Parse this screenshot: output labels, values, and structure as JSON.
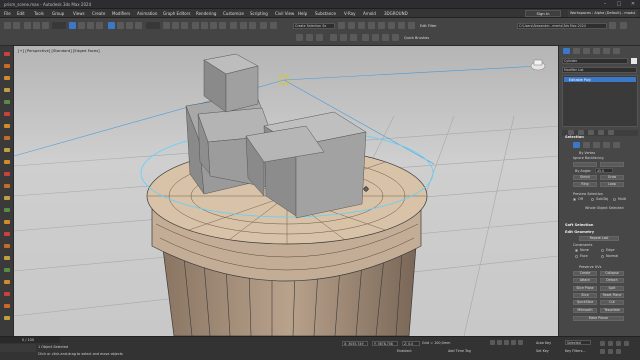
{
  "window": {
    "title": "prism_scene.max - Autodesk 3ds Max 2024"
  },
  "menu": [
    "File",
    "Edit",
    "Tools",
    "Group",
    "Views",
    "Create",
    "Modifiers",
    "Animation",
    "Graph Editors",
    "Rendering",
    "Customize",
    "Scripting",
    "Civil View",
    "Help",
    "Substance",
    "V-Ray",
    "Arnold",
    "3DGROUND"
  ],
  "signin": "Sign In",
  "workspace": "Workspaces : Alpha (Default) - modul",
  "toolbar": {
    "selection_set": "Create Selection Se",
    "path": "C:\\Users\\Alexander...ments\\3ds Max 2024",
    "quick_brushes": "Quick Brushes",
    "filter": "Edit Filter"
  },
  "viewport": {
    "label": "[+] [Perspective] [Standard] [Edged Faces]"
  },
  "command_panel": {
    "object_name": "Cylinder",
    "modifier_list": "Modifier List",
    "modifier": "Editable Poly",
    "rollouts": {
      "selection": "Selection",
      "by_vertex": "By Vertex",
      "ignore_backfacing": "Ignore Backfacing",
      "by_angle": "By Angle:",
      "angle_value": "45.0",
      "shrink": "Shrink",
      "grow": "Grow",
      "ring": "Ring",
      "loop": "Loop",
      "preview_selection": "Preview Selection",
      "off": "Off",
      "subobj": "SubObj",
      "multi": "Multi",
      "whole_object": "Whole Object Selected",
      "soft_selection": "Soft Selection",
      "edit_geometry": "Edit Geometry",
      "repeat_last": "Repeat Last",
      "constraints": "Constraints",
      "none": "None",
      "edge": "Edge",
      "face": "Face",
      "normal": "Normal",
      "preserve_uvs": "Preserve UVs",
      "create": "Create",
      "collapse": "Collapse",
      "attach": "Attach",
      "detach": "Detach",
      "slice_plane": "Slice Plane",
      "split": "Split",
      "slice": "Slice",
      "reset_plane": "Reset Plane",
      "quickslice": "QuickSlice",
      "cut": "Cut",
      "msmooth": "MSmooth",
      "tessellate": "Tessellate",
      "make_planar": "Make Planar"
    }
  },
  "status": {
    "frame": "0 / 100",
    "selected": "1 Object Selected",
    "prompt": "Click or click-and-drag to select and move objects",
    "x": "X: 3055,749",
    "y": "Y: 3678,708",
    "z": "Z: 0,0",
    "grid": "Grid = 100,0mm",
    "enabled": "Enabled:",
    "add_time_tag": "Add Time Tag",
    "auto_key": "Auto Key",
    "selected_dd": "Selected",
    "set_key": "Set Key",
    "key_filters": "Key Filters..."
  },
  "colors": {
    "accent": "#3c78c8",
    "viewport_bg": "#c4c4c4",
    "selection_cyan": "#5ad2ff"
  }
}
